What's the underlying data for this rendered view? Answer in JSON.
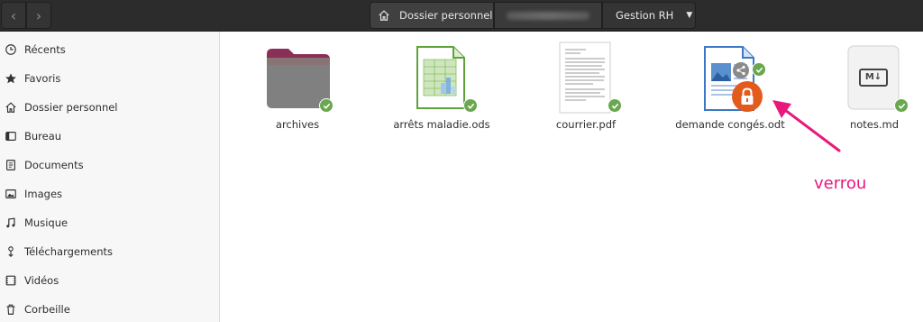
{
  "header": {
    "back_label": "‹",
    "forward_label": "›",
    "breadcrumbs": [
      "Dossier personnel",
      "Gestion RH"
    ]
  },
  "sidebar": {
    "items": [
      {
        "label": "Récents",
        "icon": "clock-icon"
      },
      {
        "label": "Favoris",
        "icon": "star-icon"
      },
      {
        "label": "Dossier personnel",
        "icon": "home-icon"
      },
      {
        "label": "Bureau",
        "icon": "desktop-icon"
      },
      {
        "label": "Documents",
        "icon": "document-icon"
      },
      {
        "label": "Images",
        "icon": "image-icon"
      },
      {
        "label": "Musique",
        "icon": "music-icon"
      },
      {
        "label": "Téléchargements",
        "icon": "download-icon"
      },
      {
        "label": "Vidéos",
        "icon": "video-icon"
      },
      {
        "label": "Corbeille",
        "icon": "trash-icon"
      }
    ]
  },
  "files": [
    {
      "name": "archives",
      "type": "folder-icon",
      "synced": true
    },
    {
      "name": "arrêts maladie.ods",
      "type": "spreadsheet-icon",
      "synced": true
    },
    {
      "name": "courrier.pdf",
      "type": "pdf-icon",
      "synced": true
    },
    {
      "name": "demande congés.odt",
      "type": "text-document-icon",
      "synced": true,
      "locked": true,
      "shared": true
    },
    {
      "name": "notes.md",
      "type": "markdown-icon",
      "synced": true
    }
  ],
  "markdown_badge": "M↓",
  "annotation": {
    "text": "verrou",
    "color": "#e8187c"
  },
  "colors": {
    "headerbar": "#2c2c2c",
    "sync_check": "#6aa84f",
    "lock": "#e25a1c",
    "accent_annotation": "#e8187c"
  }
}
